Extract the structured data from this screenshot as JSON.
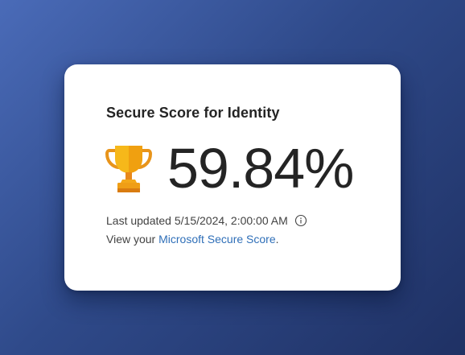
{
  "card": {
    "title": "Secure Score for Identity",
    "score": "59.84%",
    "last_updated_label": "Last updated",
    "last_updated_value": "5/15/2024, 2:00:00 AM",
    "view_prefix": "View your ",
    "link_text": "Microsoft Secure Score",
    "view_suffix": ".",
    "icons": {
      "trophy": "trophy-icon",
      "info": "info-icon"
    }
  },
  "colors": {
    "link": "#2f6fb8",
    "text_primary": "#242424",
    "text_secondary": "#424242",
    "trophy_gold": "#f5b316",
    "trophy_orange": "#e8841a",
    "card_bg": "#ffffff"
  }
}
